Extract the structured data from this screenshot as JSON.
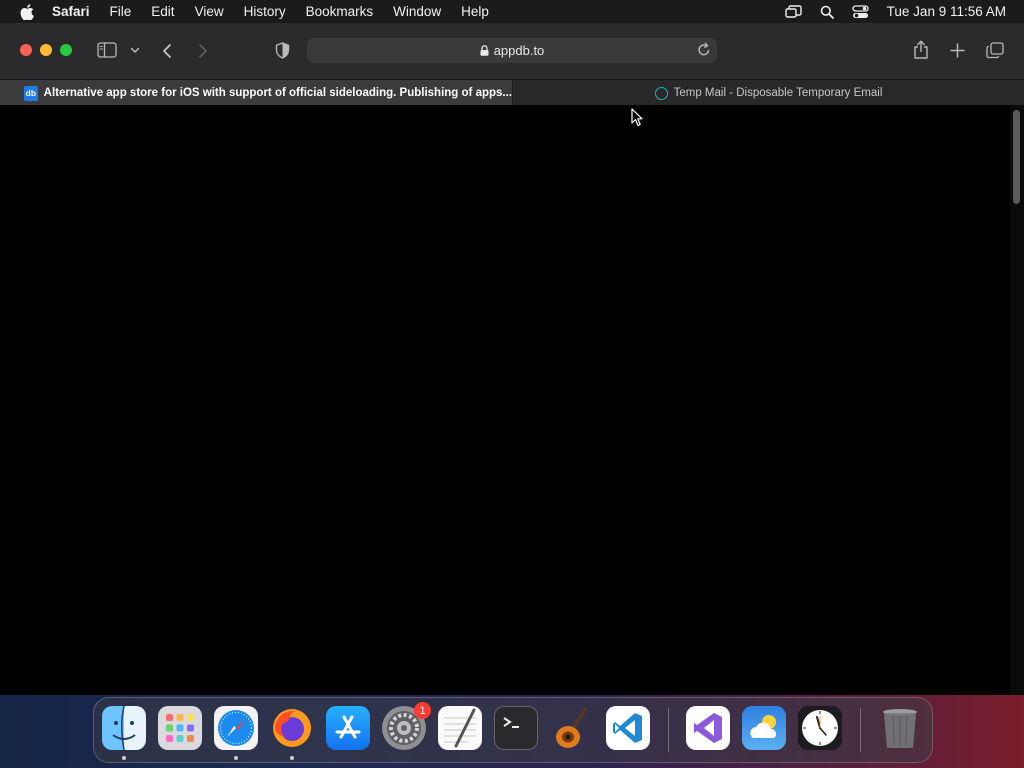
{
  "menubar": {
    "app_name": "Safari",
    "items": [
      "File",
      "Edit",
      "View",
      "History",
      "Bookmarks",
      "Window",
      "Help"
    ],
    "clock": "Tue Jan 9  11:56 AM"
  },
  "toolbar": {
    "url": "appdb.to"
  },
  "tabs": [
    {
      "title": "Alternative app store for iOS with support of official sideloading. Publishing of apps...",
      "favicon_text": "db",
      "active": true
    },
    {
      "title": "Temp Mail - Disposable Temporary Email",
      "active": false
    }
  ],
  "dock": {
    "apps": [
      {
        "name": "Finder",
        "running": true
      },
      {
        "name": "Launchpad",
        "running": false
      },
      {
        "name": "Safari",
        "running": true
      },
      {
        "name": "Firefox",
        "running": true
      },
      {
        "name": "App Store",
        "running": false
      },
      {
        "name": "System Settings",
        "running": false,
        "badge": "1"
      },
      {
        "name": "TextEdit",
        "running": false
      },
      {
        "name": "Terminal",
        "running": false
      },
      {
        "name": "GarageBand",
        "running": false
      },
      {
        "name": "Visual Studio Code",
        "running": false
      },
      {
        "name": "Visual Studio",
        "running": false
      },
      {
        "name": "Weather",
        "running": false
      },
      {
        "name": "Clock",
        "running": false
      },
      {
        "name": "Trash",
        "running": false
      }
    ]
  },
  "colors": {
    "menubar_bg": "#1b1b1d",
    "toolbar_bg": "#2b2b2d",
    "active_tab_bg": "#3b3b3e",
    "content_bg": "#000000"
  }
}
